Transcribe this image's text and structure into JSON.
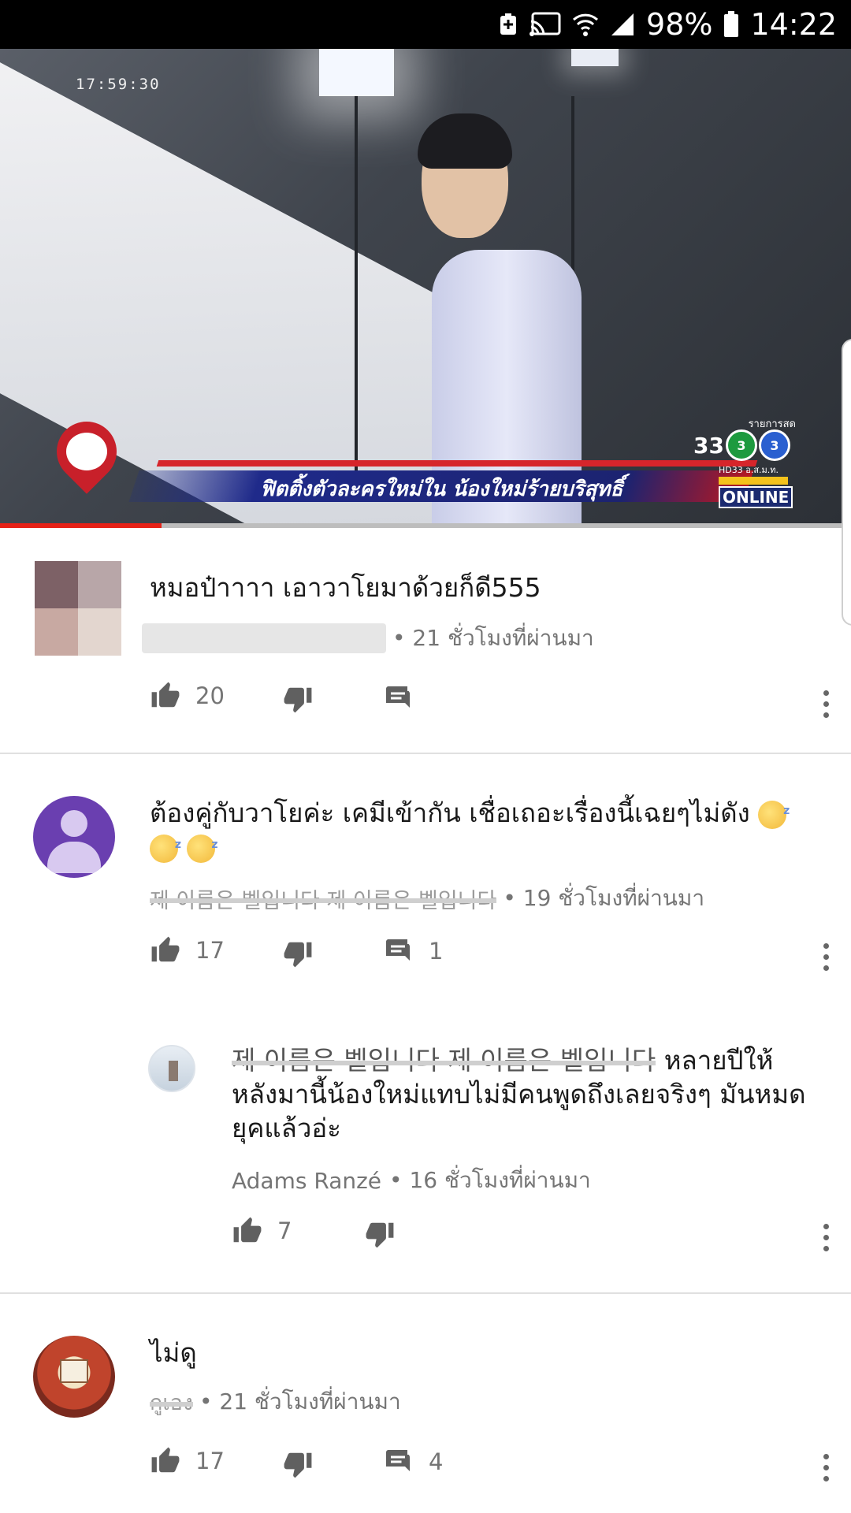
{
  "status_bar": {
    "battery": "98%",
    "time": "14:22"
  },
  "video": {
    "timecode": "17:59:30",
    "caption": "ฟิตติ้งตัวละครใหม่ใน น้องใหม่ร้ายบริสุทธิ์",
    "channel_badge_top": "รายการสด",
    "channel_badge_mid": "HD33 อ.ส.ม.ท.",
    "channel_badge_bottom": "ONLINE",
    "progress_fraction": 0.19
  },
  "comments": [
    {
      "text": "หมอป๋าาาา เอาวาโยมาด้วยก็ดี555",
      "time": "• 21 ชั่วโมงที่ผ่านมา",
      "likes": "20",
      "replies": ""
    },
    {
      "text": "ต้องคู่กับวาโยค่ะ เคมีเข้ากัน เชื่อเถอะเรื่องนี้เฉยๆไม่ดัง",
      "author": "제 이름은 벨입니다 제 이름은 벨입니다",
      "time": "• 19 ชั่วโมงที่ผ่านมา",
      "likes": "17",
      "replies": "1"
    },
    {
      "mention": "제 이름은 벨입니다 제 이름은 벨입니다",
      "text_line1": "หลายปีให้",
      "text_rest": "หลังมานี้น้องใหม่แทบไม่มีคนพูดถึงเลยจริงๆ มันหมดยุคแล้วอ่ะ",
      "author": "Adams Ranzé",
      "time": "• 16 ชั่วโมงที่ผ่านมา",
      "likes": "7"
    },
    {
      "text": "ไม่ดู",
      "author": "กูเอง",
      "time": "• 21 ชั่วโมงที่ผ่านมา",
      "likes": "17",
      "replies": "4"
    }
  ],
  "colors": {
    "accent": "#e62117",
    "avatar_purple": "#6a3fb0",
    "meta_gray": "#757575"
  }
}
